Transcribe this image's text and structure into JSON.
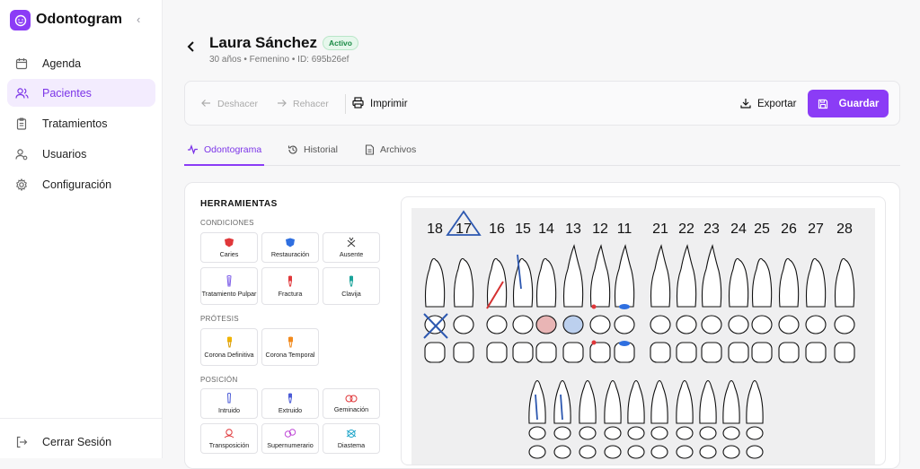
{
  "app": {
    "title": "Odontogram"
  },
  "sidebar": {
    "items": [
      {
        "label": "Agenda",
        "icon": "calendar-icon"
      },
      {
        "label": "Pacientes",
        "icon": "users-icon",
        "active": true
      },
      {
        "label": "Tratamientos",
        "icon": "clipboard-icon"
      },
      {
        "label": "Usuarios",
        "icon": "user-cog-icon"
      },
      {
        "label": "Configuración",
        "icon": "gear-icon"
      }
    ],
    "logout": "Cerrar Sesión"
  },
  "patient": {
    "name": "Laura Sánchez",
    "status": "Activo",
    "info": "30 años • Femenino • ID: 695b26ef"
  },
  "toolbar": {
    "undo": "Deshacer",
    "redo": "Rehacer",
    "print": "Imprimir",
    "export": "Exportar",
    "save": "Guardar"
  },
  "tabs": [
    {
      "label": "Odontograma",
      "active": true
    },
    {
      "label": "Historial"
    },
    {
      "label": "Archivos"
    }
  ],
  "tools": {
    "title": "HERRAMIENTAS",
    "sections": [
      {
        "name": "CONDICIONES",
        "items": [
          "Caries",
          "Restauración",
          "Ausente",
          "Tratamiento Pulpar",
          "Fractura",
          "Clavija"
        ]
      },
      {
        "name": "PRÓTESIS",
        "items": [
          "Corona Definitiva",
          "Corona Temporal"
        ]
      },
      {
        "name": "POSICIÓN",
        "items": [
          "Intruido",
          "Extruido",
          "Geminación",
          "Transposición",
          "Supernumerario",
          "Diastema"
        ]
      }
    ]
  },
  "odontogram": {
    "upper_numbers": [
      "18",
      "17",
      "16",
      "15",
      "14",
      "13",
      "12",
      "11",
      "21",
      "22",
      "23",
      "24",
      "25",
      "26",
      "27",
      "28"
    ]
  },
  "colors": {
    "accent": "#8b3cf6",
    "caries": "#e0373a",
    "restoration": "#2f6fe0"
  }
}
